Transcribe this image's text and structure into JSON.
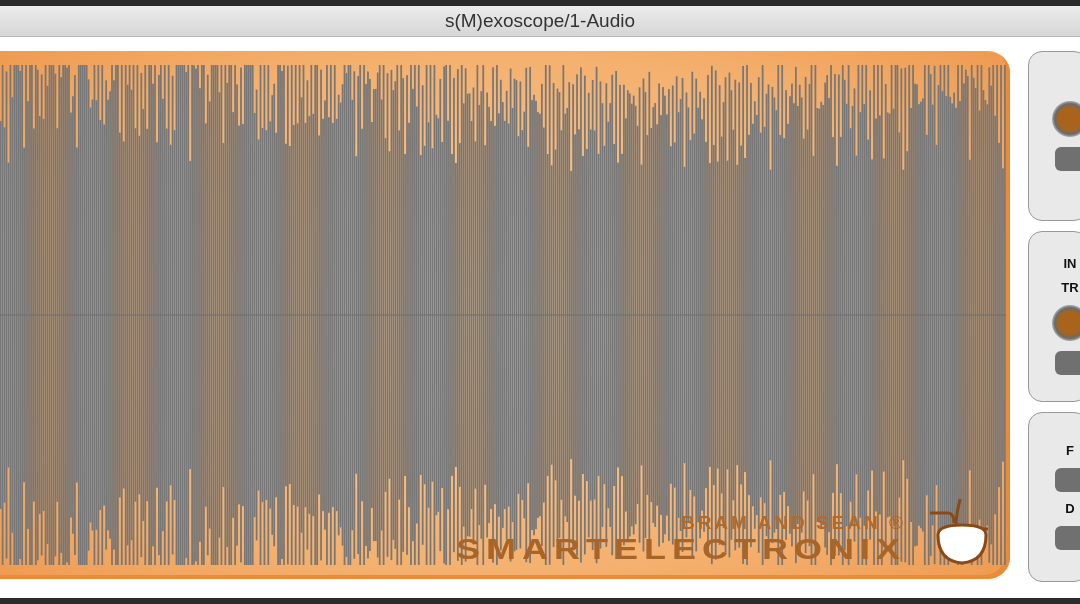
{
  "window": {
    "title": "s(M)exoscope/1-Audio"
  },
  "display": {
    "credit": "BRAM AND SEAN ®",
    "brand": "SMARTELECTRONIX"
  },
  "side_panels": [
    {
      "kind": "knob"
    },
    {
      "kind": "knob",
      "labels": [
        "IN",
        "TR"
      ]
    },
    {
      "kind": "buttons",
      "labels": [
        "F",
        "D"
      ]
    }
  ]
}
